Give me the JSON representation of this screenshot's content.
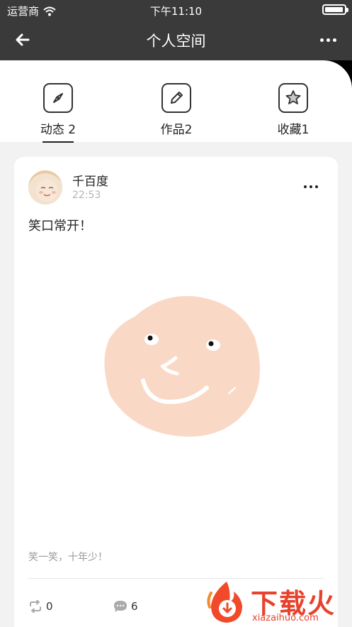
{
  "status_bar": {
    "carrier": "运营商",
    "time": "下午11:10"
  },
  "nav": {
    "title": "个人空间"
  },
  "tabs": [
    {
      "label": "动态 2",
      "icon": "compass-icon",
      "active": true
    },
    {
      "label": "作品2",
      "icon": "pencil-icon",
      "active": false
    },
    {
      "label": "收藏1",
      "icon": "star-icon",
      "active": false
    }
  ],
  "post": {
    "username": "千百度",
    "time": "22:53",
    "text": "笑口常开！",
    "caption": "笑一笑，十年少！",
    "reposts": "0",
    "comments": "6"
  },
  "watermark": {
    "text": "下载火",
    "sub": "xiazaihuo.com"
  },
  "colors": {
    "nav_bg": "#3a3a3a",
    "face": "#f9d9c6",
    "brand": "#e8412c"
  }
}
